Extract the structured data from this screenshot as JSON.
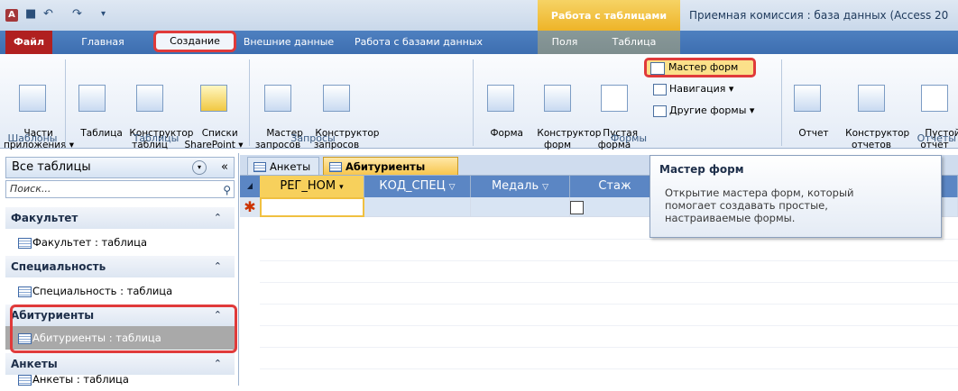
{
  "title_bar": {
    "app_icon": "A",
    "qat_icons": [
      "save-icon",
      "undo-icon",
      "redo-icon",
      "customize-icon"
    ],
    "context_title": "Работа с таблицами",
    "window_title": "Приемная комиссия : база данных (Access 20"
  },
  "tabs": {
    "file": "Файл",
    "home": "Главная",
    "create": "Создание",
    "external": "Внешние данные",
    "db_tools": "Работа с базами данных",
    "fields": "Поля",
    "table": "Таблица"
  },
  "ribbon": {
    "templates": {
      "app_parts": "Части\nприложения ▾",
      "label": "Шаблоны"
    },
    "tables": {
      "table": "Таблица",
      "designer": "Конструктор\nтаблиц",
      "sharepoint": "Списки\nSharePoint ▾",
      "label": "Таблицы"
    },
    "queries": {
      "wizard": "Мастер\nзапросов",
      "designer": "Конструктор\nзапросов",
      "label": "Запросы"
    },
    "forms": {
      "form": "Форма",
      "designer": "Конструктор\nформ",
      "blank": "Пустая\nформа",
      "wizard": "Мастер форм",
      "navigation": "Навигация ▾",
      "other": "Другие формы ▾",
      "label": "Формы"
    },
    "reports": {
      "report": "Отчет",
      "designer": "Конструктор\nотчетов",
      "blank": "Пустой\nотчет",
      "label": "Отчеты"
    }
  },
  "nav": {
    "header": "Все таблицы",
    "search_placeholder": "Поиск...",
    "groups": [
      {
        "title": "Факультет",
        "item": "Факультет : таблица"
      },
      {
        "title": "Специальность",
        "item": "Специальность : таблица"
      },
      {
        "title": "Абитуриенты",
        "item": "Абитуриенты : таблица"
      },
      {
        "title": "Анкеты",
        "item": "Анкеты : таблица"
      }
    ]
  },
  "doc": {
    "tabs": [
      "Анкеты",
      "Абитуриенты"
    ],
    "columns": [
      "РЕГ_НОМ",
      "КОД_СПЕЦ",
      "Медаль",
      "Стаж"
    ]
  },
  "tooltip": {
    "title": "Мастер форм",
    "body": "Открытие мастера форм, который помогает создавать простые, настраиваемые формы."
  }
}
